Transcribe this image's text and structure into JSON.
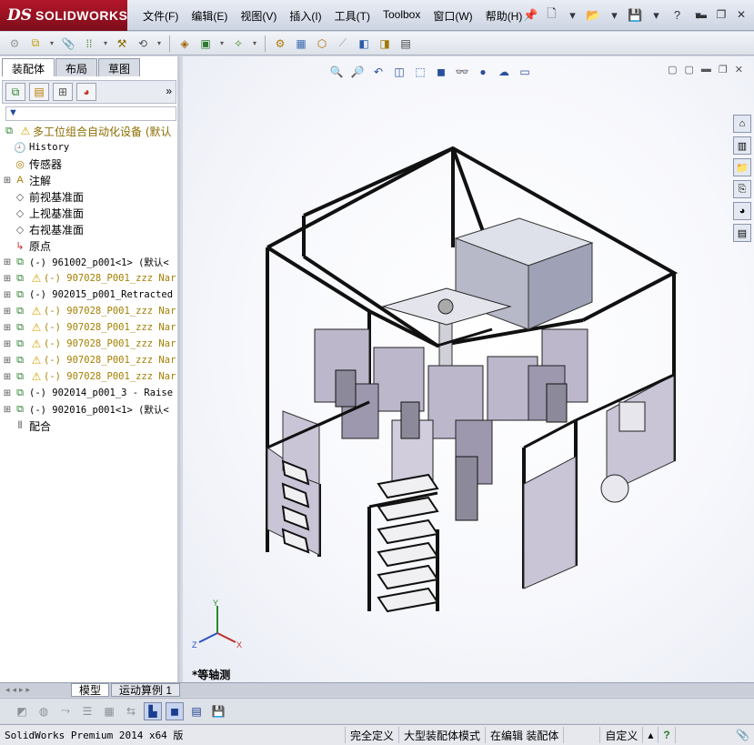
{
  "app": {
    "brand_ds": "DS",
    "brand_name": "SOLIDWORKS"
  },
  "menu": [
    "文件(F)",
    "编辑(E)",
    "视图(V)",
    "插入(I)",
    "工具(T)",
    "Toolbox",
    "窗口(W)",
    "帮助(H)"
  ],
  "panel_tabs": [
    "装配体",
    "布局",
    "草图"
  ],
  "tree": {
    "root": "多工位组合自动化设备 (默认",
    "items": [
      {
        "label": "History",
        "kind": "en"
      },
      {
        "label": "传感器",
        "kind": "cn"
      },
      {
        "label": "注解",
        "kind": "cn"
      },
      {
        "label": "前视基准面",
        "kind": "cn"
      },
      {
        "label": "上视基准面",
        "kind": "cn"
      },
      {
        "label": "右视基准面",
        "kind": "cn"
      },
      {
        "label": "原点",
        "kind": "cn"
      },
      {
        "label": "(-) 961002_p001<1> (默认<",
        "kind": "part"
      },
      {
        "label": "(-) 907028_P001_zzz Nar",
        "kind": "warn"
      },
      {
        "label": "(-) 902015_p001_Retracted",
        "kind": "part"
      },
      {
        "label": "(-) 907028_P001_zzz Nar",
        "kind": "warn"
      },
      {
        "label": "(-) 907028_P001_zzz Nar",
        "kind": "warn"
      },
      {
        "label": "(-) 907028_P001_zzz Nar",
        "kind": "warn"
      },
      {
        "label": "(-) 907028_P001_zzz Nar",
        "kind": "warn"
      },
      {
        "label": "(-) 907028_P001_zzz Nar",
        "kind": "warn"
      },
      {
        "label": "(-) 902014_p001_3 - Raise",
        "kind": "part"
      },
      {
        "label": "(-) 902016_p001<1> (默认<",
        "kind": "part"
      },
      {
        "label": "配合",
        "kind": "cn"
      }
    ]
  },
  "bottom_tabs": [
    "模型",
    "运动算例 1"
  ],
  "viewport": {
    "view_name": "*等轴测",
    "axis_x": "X",
    "axis_y": "Y",
    "axis_z": "Z"
  },
  "status": {
    "product": "SolidWorks Premium 2014 x64 版",
    "defined": "完全定义",
    "mode": "大型装配体模式",
    "editing": "在编辑 装配体",
    "custom": "自定义",
    "help": "?"
  }
}
